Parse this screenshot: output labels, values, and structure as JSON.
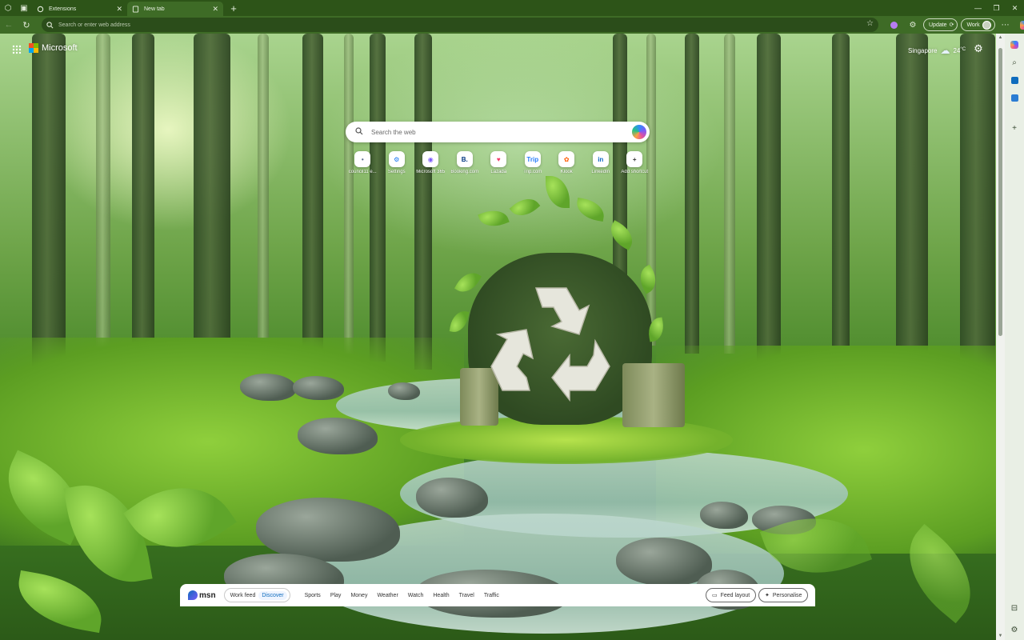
{
  "browser": {
    "tabs": [
      {
        "title": "Extensions",
        "active": false
      },
      {
        "title": "New tab",
        "active": true
      }
    ],
    "address_placeholder": "Search or enter web address",
    "update_label": "Update",
    "profile_label": "Work"
  },
  "brand": {
    "name": "Microsoft"
  },
  "weather": {
    "location": "Singapore",
    "temperature": "24",
    "unit": "°C"
  },
  "search": {
    "placeholder": "Search the web"
  },
  "quick_links": [
    {
      "label": "council11 e...",
      "glyph": "•",
      "color": "#5a6b8c"
    },
    {
      "label": "Settings",
      "glyph": "⚙",
      "color": "#1877f2"
    },
    {
      "label": "Microsoft 365",
      "glyph": "◉",
      "color": "#7a5af8"
    },
    {
      "label": "Booking.com",
      "glyph": "B.",
      "color": "#003580"
    },
    {
      "label": "Lazada",
      "glyph": "♥",
      "color": "#f33a6a"
    },
    {
      "label": "Trip.com",
      "glyph": "Trip",
      "color": "#287dfa"
    },
    {
      "label": "Klook",
      "glyph": "✿",
      "color": "#ff5b00"
    },
    {
      "label": "LinkedIn",
      "glyph": "in",
      "color": "#0a66c2"
    },
    {
      "label": "Add shortcut",
      "glyph": "+",
      "color": "#333333"
    }
  ],
  "feed": {
    "brand": "msn",
    "toggle": [
      "Work feed",
      "Discover"
    ],
    "active_toggle": "Discover",
    "nav": [
      "Sports",
      "Play",
      "Money",
      "Weather",
      "Watch",
      "Health",
      "Travel",
      "Traffic"
    ],
    "feed_layout_label": "Feed layout",
    "personalise_label": "Personalise"
  },
  "colors": {
    "accent": "#0f6cbd",
    "frame": "#2d5418",
    "toolbar": "#3e6b26"
  }
}
